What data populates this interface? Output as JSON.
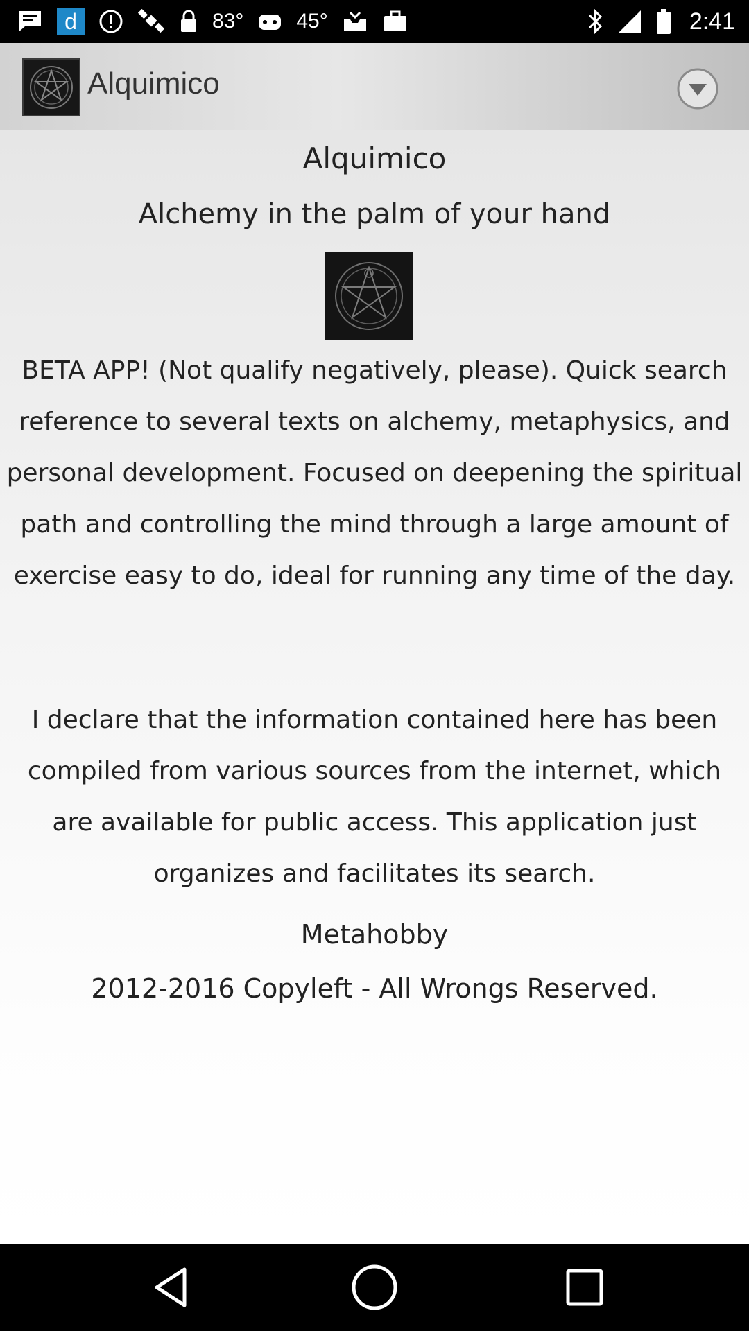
{
  "status_bar": {
    "temperature_1": "83°",
    "temperature_2": "45°",
    "d_badge": "d",
    "time": "2:41",
    "icons": [
      "message-icon",
      "d-app-icon",
      "sync-alert-icon",
      "gps-satellite-icon",
      "lock-icon",
      "gamepad-icon",
      "inbox-icon",
      "briefcase-icon",
      "bluetooth-icon",
      "signal-icon",
      "battery-icon"
    ]
  },
  "action_bar": {
    "title": "Alquimico",
    "icons": [
      "app-logo-icon",
      "overflow-dropdown-icon"
    ]
  },
  "content": {
    "title": "Alquimico",
    "tagline": "Alchemy in the palm of your hand",
    "intro": "BETA APP! (Not qualify negatively, please). Quick search reference to several texts on alchemy, metaphysics, and personal development. Focused on deepening the spiritual path and controlling the mind through a large amount of exercise easy to do, ideal for running any time of the day.",
    "disclaimer": "I declare that the information contained here has been compiled from various sources from the internet, which are available for public access. This application just organizes and facilitates its search.",
    "author": "Metahobby",
    "copyright": "2012-2016 Copyleft - All Wrongs Reserved."
  },
  "nav_bar": {
    "icons": [
      "back-icon",
      "home-icon",
      "recents-icon"
    ]
  },
  "colors": {
    "action_bar_bg": "#d8d8d8",
    "content_text": "#222222",
    "d_badge": "#1e88c8"
  }
}
